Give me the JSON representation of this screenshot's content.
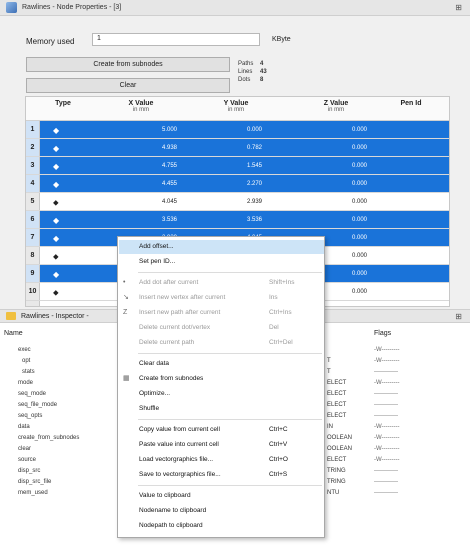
{
  "window": {
    "title": "Rawlines - Node Properties - [3]"
  },
  "memory": {
    "label": "Memory used",
    "value": "1",
    "unit": "KByte"
  },
  "buttons": {
    "create": "Create from subnodes",
    "clear": "Clear"
  },
  "stats": {
    "paths_label": "Paths",
    "paths": "4",
    "lines_label": "Lines",
    "lines": "43",
    "dots_label": "Dots",
    "dots": "8"
  },
  "table": {
    "columns": [
      {
        "title": "Type",
        "unit": ""
      },
      {
        "title": "X Value",
        "unit": "in mm"
      },
      {
        "title": "Y Value",
        "unit": "in mm"
      },
      {
        "title": "Z Value",
        "unit": "in mm"
      },
      {
        "title": "Pen Id",
        "unit": ""
      }
    ],
    "rows": [
      {
        "n": "1",
        "x": "5.000",
        "y": "0.000",
        "z": "0.000",
        "sel": true
      },
      {
        "n": "2",
        "x": "4.938",
        "y": "0.782",
        "z": "0.000",
        "sel": true
      },
      {
        "n": "3",
        "x": "4.755",
        "y": "1.545",
        "z": "0.000",
        "sel": true
      },
      {
        "n": "4",
        "x": "4.455",
        "y": "2.270",
        "z": "0.000",
        "sel": true
      },
      {
        "n": "5",
        "x": "4.045",
        "y": "2.939",
        "z": "0.000",
        "sel": false
      },
      {
        "n": "6",
        "x": "3.536",
        "y": "3.536",
        "z": "0.000",
        "sel": true
      },
      {
        "n": "7",
        "x": "2.939",
        "y": "4.045",
        "z": "0.000",
        "sel": true
      },
      {
        "n": "8",
        "x": "",
        "y": "",
        "z": "0.000",
        "sel": false
      },
      {
        "n": "9",
        "x": "",
        "y": "",
        "z": "0.000",
        "sel": true
      },
      {
        "n": "10",
        "x": "",
        "y": "",
        "z": "0.000",
        "sel": false
      },
      {
        "n": "11",
        "x": "",
        "y": "",
        "z": "0.000",
        "sel": false
      }
    ]
  },
  "inspector": {
    "title": "Rawlines - Inspector -",
    "col_name": "Name",
    "col_flags": "Flags",
    "props": [
      "exec",
      "opt",
      "stats",
      "mode",
      "seq_mode",
      "seq_file_mode",
      "seq_opts",
      "data",
      "create_from_subnodes",
      "clear",
      "source",
      "disp_src",
      "disp_src_file",
      "mem_used"
    ],
    "types": [
      "",
      "",
      "",
      "ELECT",
      "ELECT",
      "ELECT",
      "ELECT",
      "IN",
      "OOLEAN",
      "OOLEAN",
      "ELECT",
      "TRING",
      "TRING",
      "NTU"
    ],
    "types_top": [
      "",
      "T",
      "T"
    ],
    "flags": [
      "-W---------",
      "-W---------",
      "------------",
      "-W---------",
      "------------",
      "------------",
      "------------",
      "-W---------",
      "-W---------",
      "-W---------",
      "-W---------",
      "------------",
      "------------",
      "------------"
    ]
  },
  "menu": {
    "items": [
      {
        "label": "Add offset...",
        "shortcut": "",
        "disabled": false,
        "hl": true,
        "icon": ""
      },
      {
        "label": "Set pen ID...",
        "shortcut": "",
        "disabled": false,
        "hl": false,
        "icon": ""
      },
      {
        "label": "Add dot after current",
        "shortcut": "Shift+Ins",
        "disabled": true,
        "hl": false,
        "icon": "•"
      },
      {
        "label": "Insert new vertex after current",
        "shortcut": "Ins",
        "disabled": true,
        "hl": false,
        "icon": "↘"
      },
      {
        "label": "Insert new path after current",
        "shortcut": "Ctrl+Ins",
        "disabled": true,
        "hl": false,
        "icon": "Z"
      },
      {
        "label": "Delete current dot/vertex",
        "shortcut": "Del",
        "disabled": true,
        "hl": false,
        "icon": ""
      },
      {
        "label": "Delete current path",
        "shortcut": "Ctrl+Del",
        "disabled": true,
        "hl": false,
        "icon": ""
      },
      {
        "label": "Clear data",
        "shortcut": "",
        "disabled": false,
        "hl": false,
        "icon": ""
      },
      {
        "label": "Create from subnodes",
        "shortcut": "",
        "disabled": false,
        "hl": false,
        "icon": "▦"
      },
      {
        "label": "Optimize...",
        "shortcut": "",
        "disabled": false,
        "hl": false,
        "icon": ""
      },
      {
        "label": "Shuffle",
        "shortcut": "",
        "disabled": false,
        "hl": false,
        "icon": ""
      },
      {
        "label": "Copy value from current cell",
        "shortcut": "Ctrl+C",
        "disabled": false,
        "hl": false,
        "icon": ""
      },
      {
        "label": "Paste value into current cell",
        "shortcut": "Ctrl+V",
        "disabled": false,
        "hl": false,
        "icon": ""
      },
      {
        "label": "Load vectorgraphics file...",
        "shortcut": "Ctrl+O",
        "disabled": false,
        "hl": false,
        "icon": ""
      },
      {
        "label": "Save to vectorgraphics file...",
        "shortcut": "Ctrl+S",
        "disabled": false,
        "hl": false,
        "icon": ""
      },
      {
        "label": "Value to clipboard",
        "shortcut": "",
        "disabled": false,
        "hl": false,
        "icon": ""
      },
      {
        "label": "Nodename to clipboard",
        "shortcut": "",
        "disabled": false,
        "hl": false,
        "icon": ""
      },
      {
        "label": "Nodepath to clipboard",
        "shortcut": "",
        "disabled": false,
        "hl": false,
        "icon": ""
      }
    ]
  }
}
